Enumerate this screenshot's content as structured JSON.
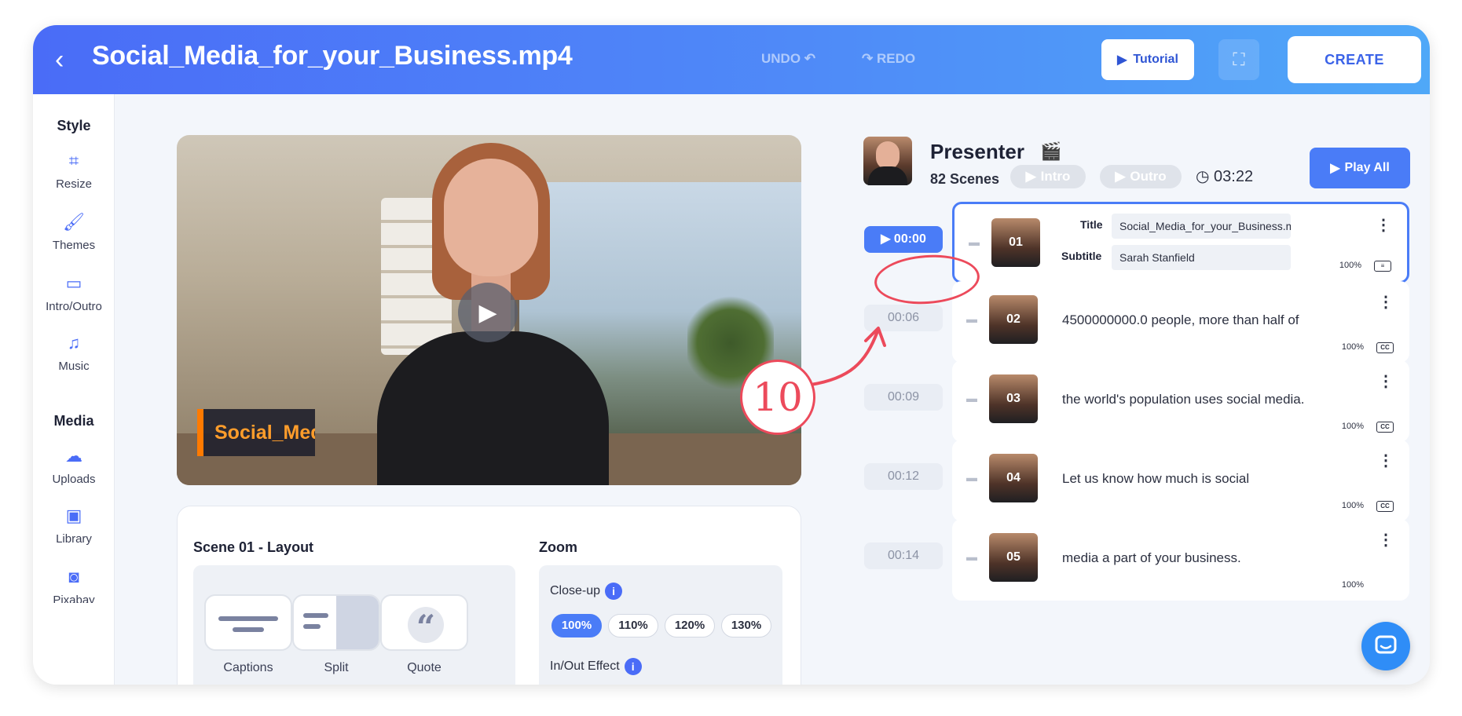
{
  "header": {
    "title": "Social_Media_for_your_Business.mp4",
    "undo": "UNDO",
    "redo": "REDO",
    "tutorial": "Tutorial",
    "create": "CREATE"
  },
  "sidebar": {
    "style_heading": "Style",
    "media_heading": "Media",
    "style_items": [
      {
        "label": "Resize",
        "icon": "crop-icon"
      },
      {
        "label": "Themes",
        "icon": "brush-icon"
      },
      {
        "label": "Intro/Outro",
        "icon": "id-card-icon"
      },
      {
        "label": "Music",
        "icon": "music-note-icon"
      }
    ],
    "media_items": [
      {
        "label": "Uploads",
        "icon": "cloud-upload-icon"
      },
      {
        "label": "Library",
        "icon": "play-folder-icon"
      },
      {
        "label": "Pixabay",
        "icon": "camera-icon"
      }
    ]
  },
  "preview": {
    "lower_third": "Social_Med"
  },
  "layout_panel": {
    "title": "Scene 01 - Layout",
    "options": [
      "Captions",
      "Split",
      "Quote"
    ],
    "zoom_title": "Zoom",
    "closeup_label": "Close-up",
    "zoom_options": [
      "100%",
      "110%",
      "120%",
      "130%"
    ],
    "zoom_selected": "100%",
    "inout_label": "In/Out Effect"
  },
  "presenter": {
    "name": "Presenter",
    "scenes": "82 Scenes",
    "intro": "Intro",
    "outro": "Outro",
    "duration": "03:22",
    "play_all": "Play All"
  },
  "scenes": [
    {
      "time": "00:00",
      "num": "01",
      "title_label": "Title",
      "title_value": "Social_Media_for_your_Business.m...",
      "subtitle_label": "Subtitle",
      "subtitle_value": "Sarah Stanfield",
      "zoom": "100%",
      "selected": true
    },
    {
      "time": "00:06",
      "num": "02",
      "text": "4500000000.0 people, more than half of",
      "zoom": "100%"
    },
    {
      "time": "00:09",
      "num": "03",
      "text": "the world's population uses social media.",
      "zoom": "100%"
    },
    {
      "time": "00:12",
      "num": "04",
      "text": "Let us know how much is social",
      "zoom": "100%"
    },
    {
      "time": "00:14",
      "num": "05",
      "text": "media a part of your business.",
      "zoom": "100%"
    }
  ],
  "annotation": {
    "step": "10",
    "color": "#ec4a5b"
  },
  "colors": {
    "accent": "#4a7cf7",
    "header_gradient_start": "#4a6cf7",
    "header_gradient_end": "#4fa8f8",
    "lower_third_accent": "#ff7a00"
  }
}
